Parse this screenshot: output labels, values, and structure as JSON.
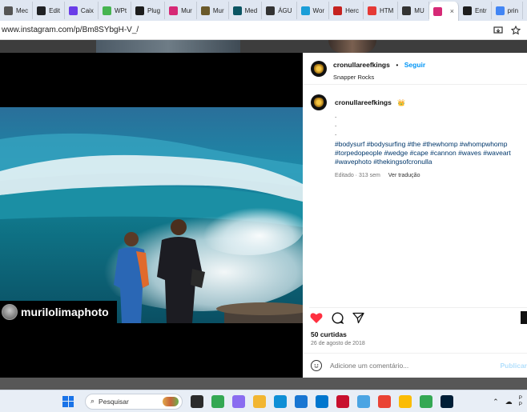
{
  "browser": {
    "tabs": [
      {
        "label": "Mec",
        "color": "#555555",
        "active": false
      },
      {
        "label": "Edit",
        "color": "#202124",
        "active": false
      },
      {
        "label": "Caix",
        "color": "#6a3de8",
        "active": false
      },
      {
        "label": "WPt",
        "color": "#46b450",
        "active": false
      },
      {
        "label": "Plug",
        "color": "#1d1d1d",
        "active": false
      },
      {
        "label": "Mur",
        "color": "#d62976",
        "active": false
      },
      {
        "label": "Mur",
        "color": "#6b5a2a",
        "active": false
      },
      {
        "label": "Med",
        "color": "#0b5563",
        "active": false
      },
      {
        "label": "ÁGU",
        "color": "#333333",
        "active": false
      },
      {
        "label": "Wor",
        "color": "#1a9ed8",
        "active": false
      },
      {
        "label": "Herc",
        "color": "#c5221f",
        "active": false
      },
      {
        "label": "HTM",
        "color": "#e53935",
        "active": false
      },
      {
        "label": "MU",
        "color": "#333333",
        "active": false
      },
      {
        "label": "",
        "color": "#d62976",
        "active": true
      },
      {
        "label": "Entr",
        "color": "#1d1d1d",
        "active": false
      },
      {
        "label": "prin",
        "color": "#4285f4",
        "active": false
      }
    ],
    "url": "www.instagram.com/p/Bm8SYbgH-V_/"
  },
  "post": {
    "watermark": "murilolimaphoto",
    "header": {
      "username": "cronullareefkings",
      "dot": "•",
      "follow": "Seguir",
      "location": "Snapper Rocks",
      "more": "•••"
    },
    "caption": {
      "username": "cronullareefkings",
      "crown": "👑",
      "lines": [
        ".",
        ".",
        "."
      ],
      "hashtags": "#bodysurf #bodysurfing #the #thewhomp #whompwhomp #torpedopeople #wedge #cape #cannon #waves #waveart #wavephoto #thekingsofcronulla",
      "edited": "Editado · 313 sem",
      "translate": "Ver tradução"
    },
    "likes": "50 curtidas",
    "date": "26 de agosto de 2018",
    "comment_placeholder": "Adicione um comentário...",
    "publish": "Publicar",
    "like_color": "#ff3040"
  },
  "taskbar": {
    "search_placeholder": "Pesquisar",
    "apps": [
      {
        "name": "file-explorer-dark-icon",
        "color": "#2b2b2b"
      },
      {
        "name": "chrome-icon",
        "color": "#34a853"
      },
      {
        "name": "copilot-icon",
        "color": "#8a6cf0"
      },
      {
        "name": "folder-icon",
        "color": "#f2b632"
      },
      {
        "name": "edge-icon",
        "color": "#0f8fd6"
      },
      {
        "name": "store-icon",
        "color": "#1976d2"
      },
      {
        "name": "dell-icon",
        "color": "#0076ce"
      },
      {
        "name": "mcafee-icon",
        "color": "#c8102e"
      },
      {
        "name": "notepad-icon",
        "color": "#4aa4e3"
      },
      {
        "name": "chrome-profile-1-icon",
        "color": "#ea4335"
      },
      {
        "name": "chrome-profile-2-icon",
        "color": "#fbbc05"
      },
      {
        "name": "chrome-profile-3-icon",
        "color": "#34a853"
      },
      {
        "name": "photoshop-icon",
        "color": "#001e36"
      }
    ]
  }
}
